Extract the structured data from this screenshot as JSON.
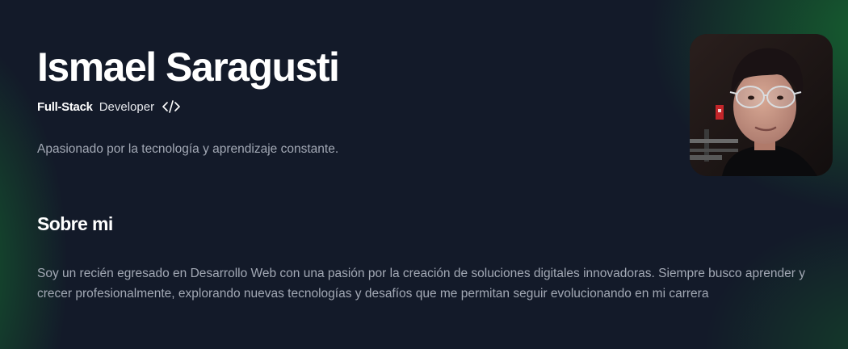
{
  "profile": {
    "name": "Ismael Saragusti",
    "role_strong": "Full-Stack",
    "role_rest": "Developer",
    "tagline": "Apasionado por la tecnología y aprendizaje constante."
  },
  "about": {
    "title": "Sobre mi",
    "body": "Soy un recién egresado en Desarrollo Web con una pasión por la creación de soluciones digitales innovadoras. Siempre busco aprender y crecer profesionalmente, explorando nuevas tecnologías y desafíos que me permitan seguir evolucionando en mi carrera"
  },
  "icons": {
    "role_icon": "code-icon",
    "profile_photo": "avatar"
  },
  "colors": {
    "background": "#131a29",
    "accent_green": "#16702f",
    "text_primary": "#ffffff",
    "text_muted": "#a3a9b5"
  }
}
